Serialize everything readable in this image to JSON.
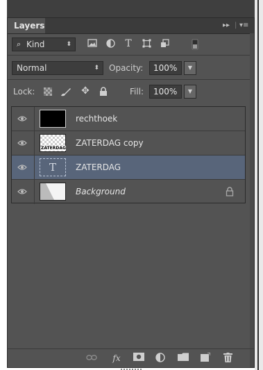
{
  "panel": {
    "tab_label": "Layers",
    "tab_controls": [
      "▸▸",
      "|",
      "▾≡"
    ]
  },
  "filter": {
    "kind_label": "Kind",
    "kind_arrows": "⬍",
    "icons": [
      "image-filter-icon",
      "adjustment-filter-icon",
      "type-filter-icon",
      "shape-filter-icon",
      "smart-object-filter-icon",
      "filter-toggle-icon"
    ]
  },
  "blend": {
    "mode": "Normal",
    "opacity_label": "Opacity:",
    "opacity_value": "100%"
  },
  "lock": {
    "lock_label": "Lock:",
    "fill_label": "Fill:",
    "fill_value": "100%"
  },
  "layers": [
    {
      "name": "rechthoek",
      "thumb": "black",
      "visible": true,
      "selected": false,
      "locked": false
    },
    {
      "name": "ZATERDAG copy",
      "thumb": "checker",
      "visible": true,
      "selected": false,
      "locked": false,
      "thumb_text": "ZATERDAG"
    },
    {
      "name": "ZATERDAG",
      "thumb": "type",
      "visible": true,
      "selected": true,
      "locked": false,
      "thumb_glyph": "T"
    },
    {
      "name": "Background",
      "thumb": "bg",
      "visible": true,
      "selected": false,
      "locked": true
    }
  ],
  "footer": {
    "buttons": [
      "link-layers-icon",
      "fx-icon",
      "add-mask-icon",
      "new-adjustment-icon",
      "new-group-icon",
      "new-layer-icon",
      "delete-layer-icon"
    ],
    "fx_label": "fx"
  }
}
